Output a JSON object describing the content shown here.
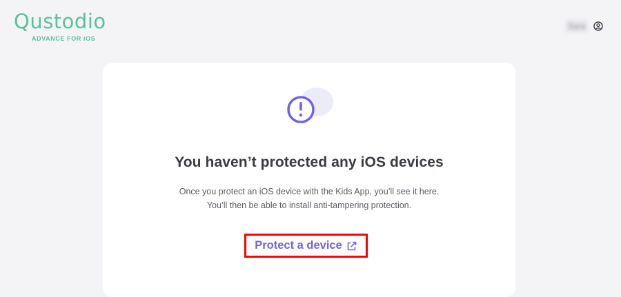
{
  "header": {
    "logo_text": "Qustodio",
    "logo_subtitle": "ADVANCE FOR iOS",
    "account_name": "Sara"
  },
  "empty_state": {
    "title": "You haven’t protected any iOS devices",
    "description_line1": "Once you protect an iOS device with the Kids App, you’ll see it here.",
    "description_line2": "You’ll then be able to install anti-tampering protection.",
    "cta_label": "Protect a device",
    "cta_icon": "external-link-icon",
    "alert_icon": "exclamation-circle-icon"
  },
  "colors": {
    "brand_green": "#57c29a",
    "accent_purple": "#6e63e6",
    "highlight_red": "#ff0000",
    "background": "#f4f4f7"
  }
}
